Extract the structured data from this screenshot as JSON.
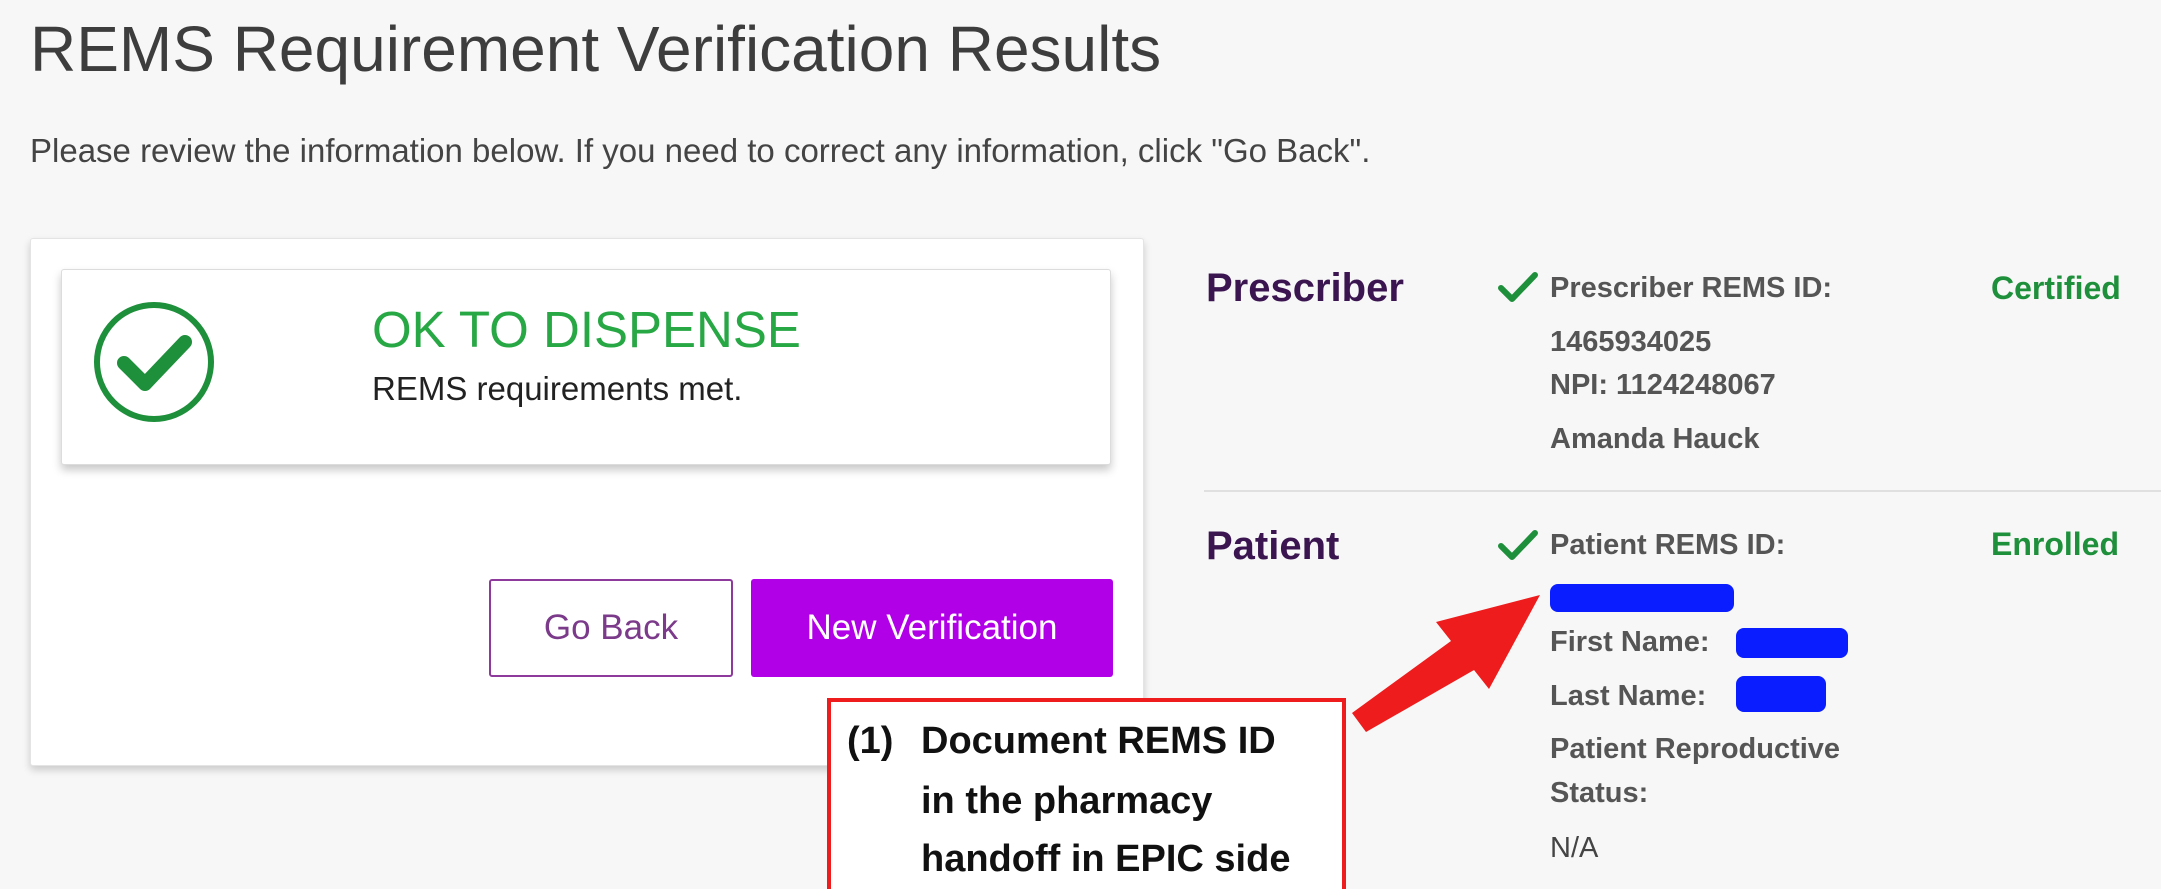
{
  "page": {
    "title": "REMS Requirement Verification Results",
    "subtitle": "Please review the information below. If you need to correct any information, click \"Go Back\"."
  },
  "status": {
    "title": "OK TO DISPENSE",
    "description": "REMS requirements met.",
    "color": "#28a745"
  },
  "buttons": {
    "go_back": "Go Back",
    "new_verification": "New Verification"
  },
  "prescriber": {
    "heading": "Prescriber",
    "rems_label": "Prescriber REMS ID:",
    "rems_id": "1465934025",
    "npi": "NPI: 1124248067",
    "name": "Amanda Hauck",
    "status": "Certified"
  },
  "patient": {
    "heading": "Patient",
    "rems_label": "Patient REMS ID:",
    "first_name_label": "First Name:",
    "last_name_label": "Last Name:",
    "reproductive_label_line1": "Patient Reproductive",
    "reproductive_label_line2": "Status:",
    "reproductive_value": "N/A",
    "status": "Enrolled"
  },
  "callout": {
    "number": "(1)",
    "line1": "Document REMS ID",
    "line2": "in the pharmacy",
    "line3": "handoff in EPIC side"
  },
  "colors": {
    "accent_purple": "#b100e8",
    "heading_purple": "#3b1550",
    "success_green": "#1e8f3b",
    "redaction_blue": "#0a1dff",
    "callout_red": "#ee1c1c"
  }
}
